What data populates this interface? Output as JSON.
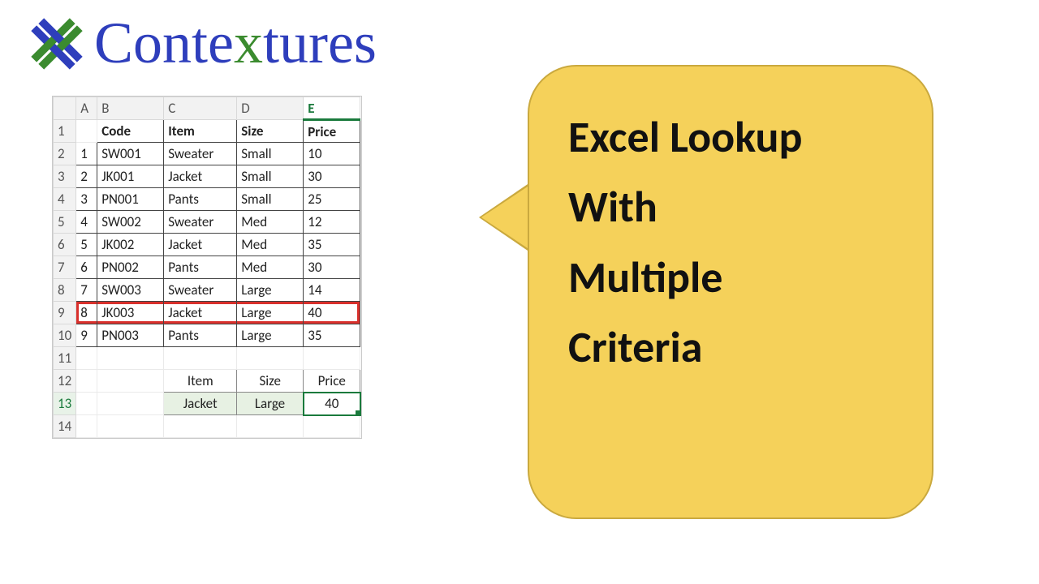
{
  "brand": {
    "name_pre": "Conte",
    "name_x": "x",
    "name_post": "tures"
  },
  "callout": {
    "line1": "Excel Lookup",
    "line2": "With",
    "line3": "Multiple",
    "line4": "Criteria"
  },
  "colors": {
    "accent_green": "#1a7a3c",
    "callout_fill": "#f5d15a",
    "highlight_red": "#d9302c",
    "brand_blue": "#2e3ebc"
  },
  "sheet": {
    "columns": [
      "A",
      "B",
      "C",
      "D",
      "E"
    ],
    "row_numbers": [
      "1",
      "2",
      "3",
      "4",
      "5",
      "6",
      "7",
      "8",
      "9",
      "10",
      "11",
      "12",
      "13",
      "14"
    ],
    "headers": {
      "code": "Code",
      "item": "Item",
      "size": "Size",
      "price": "Price"
    },
    "rows": [
      {
        "n": "1",
        "code": "SW001",
        "item": "Sweater",
        "size": "Small",
        "price": "10"
      },
      {
        "n": "2",
        "code": "JK001",
        "item": "Jacket",
        "size": "Small",
        "price": "30"
      },
      {
        "n": "3",
        "code": "PN001",
        "item": "Pants",
        "size": "Small",
        "price": "25"
      },
      {
        "n": "4",
        "code": "SW002",
        "item": "Sweater",
        "size": "Med",
        "price": "12"
      },
      {
        "n": "5",
        "code": "JK002",
        "item": "Jacket",
        "size": "Med",
        "price": "35"
      },
      {
        "n": "6",
        "code": "PN002",
        "item": "Pants",
        "size": "Med",
        "price": "30"
      },
      {
        "n": "7",
        "code": "SW003",
        "item": "Sweater",
        "size": "Large",
        "price": "14"
      },
      {
        "n": "8",
        "code": "JK003",
        "item": "Jacket",
        "size": "Large",
        "price": "40"
      },
      {
        "n": "9",
        "code": "PN003",
        "item": "Pants",
        "size": "Large",
        "price": "35"
      }
    ],
    "highlight_row_n": "8",
    "selected_column": "E",
    "lookup": {
      "headers": {
        "item": "Item",
        "size": "Size",
        "price": "Price"
      },
      "values": {
        "item": "Jacket",
        "size": "Large",
        "price": "40"
      }
    }
  }
}
